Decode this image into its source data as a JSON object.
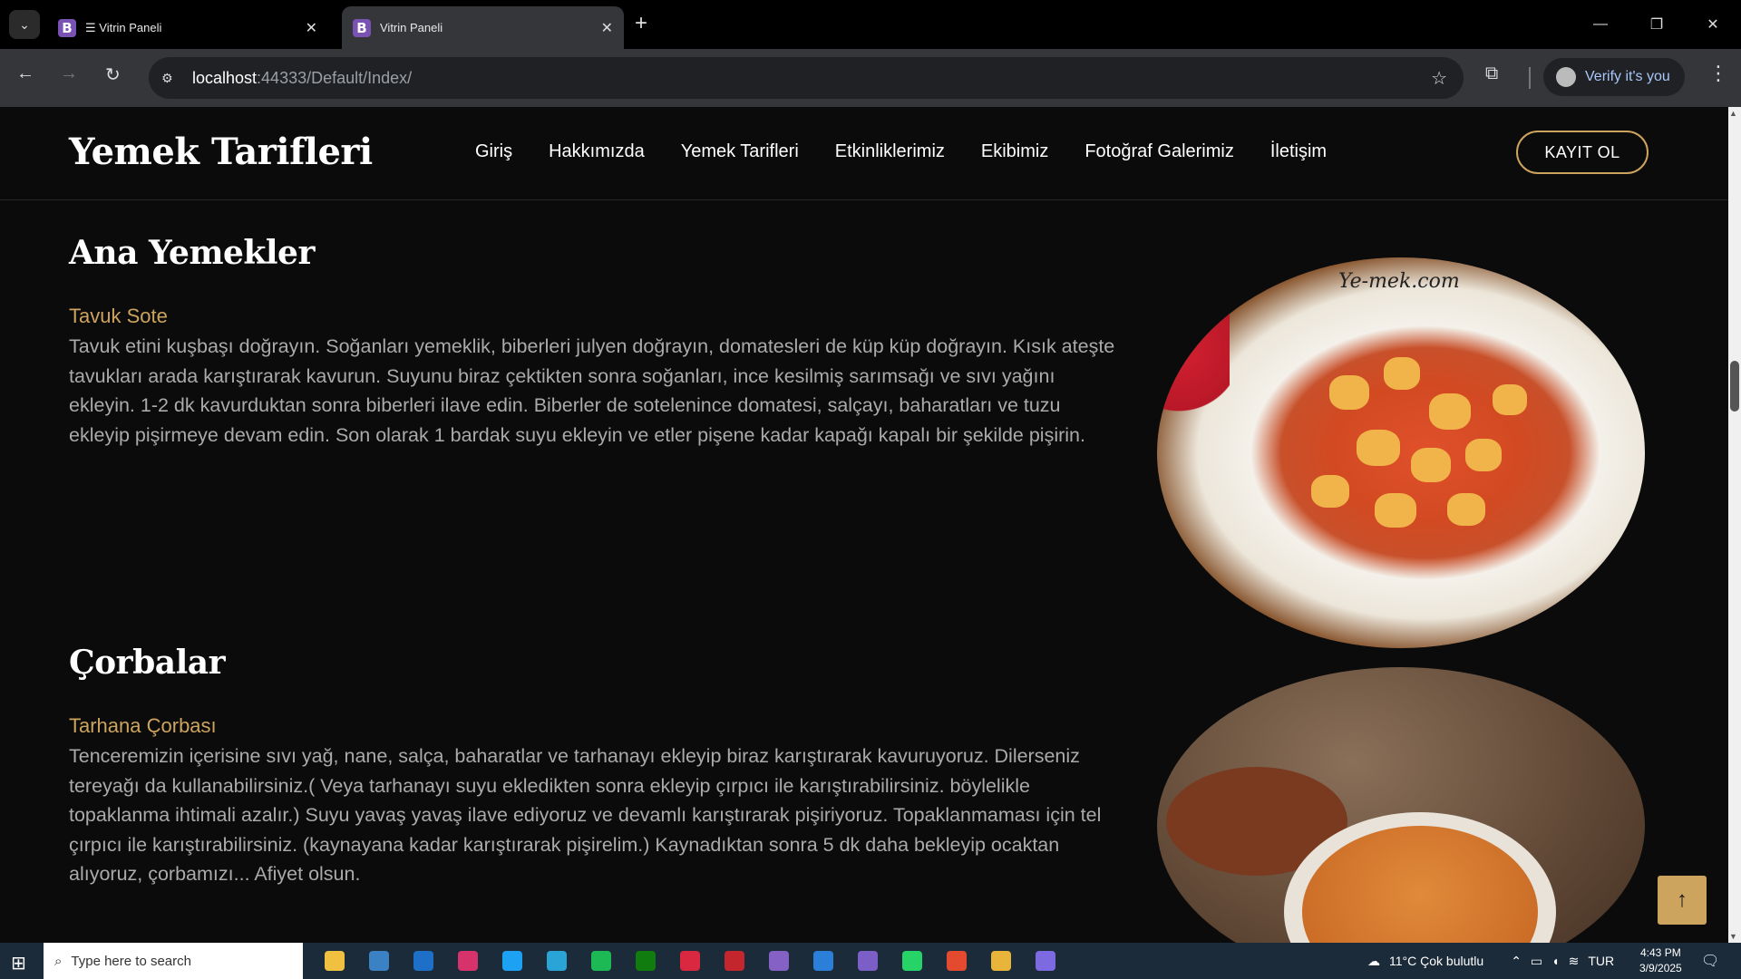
{
  "browser": {
    "tabs": [
      {
        "label": "☰ Vitrin Paneli",
        "favicon": "B"
      },
      {
        "label": "Vitrin Paneli",
        "favicon": "B"
      }
    ],
    "url_host": "localhost",
    "url_path": ":44333/Default/Index/",
    "profile_label": "Verify it's you"
  },
  "site": {
    "logo": "Yemek Tarifleri",
    "nav": [
      "Giriş",
      "Hakkımızda",
      "Yemek Tarifleri",
      "Etkinliklerimiz",
      "Ekibimiz",
      "Fotoğraf Galerimiz",
      "İletişim"
    ],
    "signup_label": "KAYIT OL"
  },
  "sections": [
    {
      "title": "Ana Yemekler",
      "recipe": "Tavuk Sote",
      "text": "Tavuk etini kuşbaşı doğrayın. Soğanları yemeklik, biberleri julyen doğrayın, domatesleri de küp küp doğrayın. Kısık ateşte tavukları arada karıştırarak kavurun. Suyunu biraz çektikten sonra soğanları, ince kesilmiş sarımsağı ve sıvı yağını ekleyin. 1-2 dk kavurduktan sonra biberleri ilave edin. Biberler de sotelenince domatesi, salçayı, baharatları ve tuzu ekleyip pişirmeye devam edin. Son olarak 1 bardak suyu ekleyin ve etler pişene kadar kapağı kapalı bir şekilde pişirin.",
      "image_watermark": "Ye-mek.com"
    },
    {
      "title": "Çorbalar",
      "recipe": "Tarhana Çorbası",
      "text": "Tenceremizin içerisine sıvı yağ, nane, salça, baharatlar ve tarhanayı ekleyip biraz karıştırarak kavuruyoruz. Dilerseniz tereyağı da kullanabilirsiniz.( Veya tarhanayı suyu ekledikten sonra ekleyip çırpıcı ile karıştırabilirsiniz. böylelikle topaklanma ihtimali azalır.) Suyu yavaş yavaş ilave ediyoruz ve devamlı karıştırarak pişiriyoruz. Topaklanmaması için tel çırpıcı ile karıştırabilirsiniz. (kaynayana kadar karıştırarak pişirelim.) Kaynadıktan sonra 5 dk daha bekleyip ocaktan alıyoruz, çorbamızı... Afiyet olsun."
    }
  ],
  "taskbar": {
    "search_placeholder": "Type here to search",
    "weather": "11°C  Çok bulutlu",
    "lang": "TUR",
    "time": "4:43 PM",
    "date": "3/9/2025",
    "app_colors": [
      "#f0c040",
      "#3b82c4",
      "#1e6fc8",
      "#d6336c",
      "#1da1f2",
      "#2aa3d6",
      "#1db954",
      "#107c10",
      "#d9283f",
      "#c4262e",
      "#8661c5",
      "#2b7fd8",
      "#7b5ec6",
      "#25d366",
      "#e44a2f",
      "#e8b43a",
      "#7d6ae0"
    ]
  },
  "colors": {
    "accent": "#cda45e",
    "background": "#0b0b0b",
    "text_muted": "#aaaaaa"
  }
}
